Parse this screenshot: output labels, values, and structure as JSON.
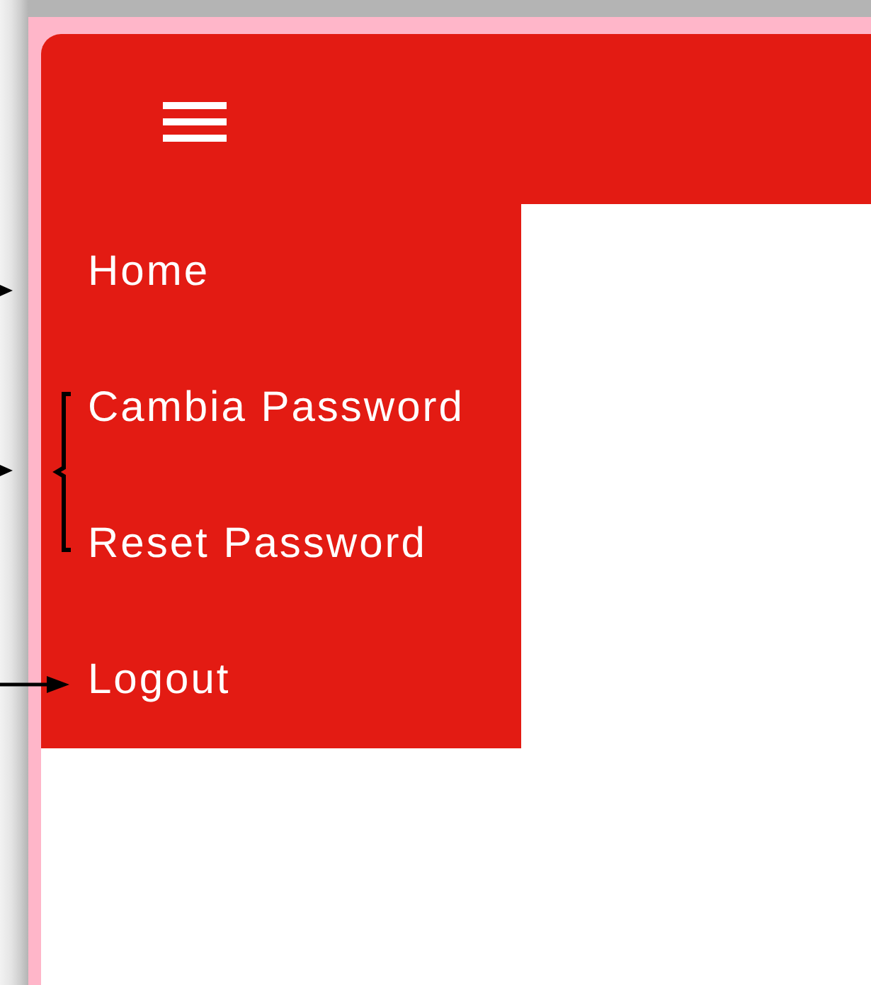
{
  "sidebar": {
    "items": [
      {
        "label": "Home"
      },
      {
        "label": "Cambia Password"
      },
      {
        "label": "Reset Password"
      },
      {
        "label": "Logout"
      }
    ]
  }
}
